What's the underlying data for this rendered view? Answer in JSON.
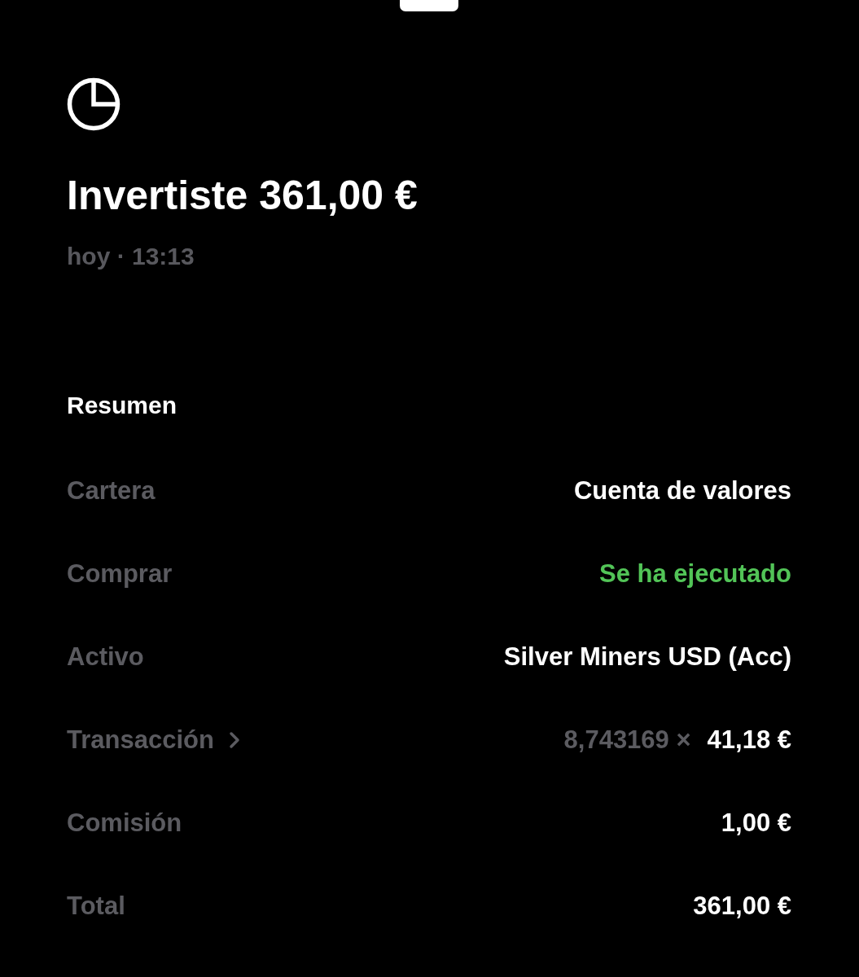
{
  "header": {
    "title": "Invertiste 361,00 €",
    "subtitle": "hoy · 13:13"
  },
  "summary": {
    "heading": "Resumen",
    "rows": [
      {
        "kind": "text",
        "label": "Cartera",
        "value": "Cuenta de valores"
      },
      {
        "kind": "status",
        "label": "Comprar",
        "value": "Se ha ejecutado"
      },
      {
        "kind": "text",
        "label": "Activo",
        "value": "Silver Miners USD (Acc)"
      },
      {
        "kind": "trade",
        "label": "Transacción",
        "quantity": "8,743169 ×",
        "value": "41,18 €"
      },
      {
        "kind": "text",
        "label": "Comisión",
        "value": "1,00 €"
      },
      {
        "kind": "text",
        "label": "Total",
        "value": "361,00 €"
      }
    ]
  }
}
